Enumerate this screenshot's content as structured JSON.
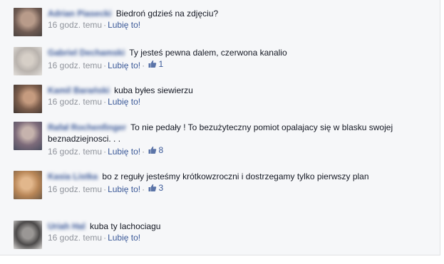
{
  "colors": {
    "link": "#3b5998",
    "meta": "#90949c",
    "text": "#141823",
    "panel": "#f6f7f9"
  },
  "comments": [
    {
      "name": "Adrian Piasecki",
      "text": "Biedroń gdzieś na zdjęciu?",
      "time": "16 godz. temu",
      "like_label": "Lubię to!",
      "like_count": null
    },
    {
      "name": "Gabriel Dechamski",
      "text": "Ty jesteś pewna dalem, czerwona kanalio",
      "time": "16 godz. temu",
      "like_label": "Lubię to!",
      "like_count": "1"
    },
    {
      "name": "Kamil Barański",
      "text": "kuba byłes siewierzu",
      "time": "16 godz. temu",
      "like_label": "Lubię to!",
      "like_count": null
    },
    {
      "name": "Rafał Rochenfinger",
      "text": "To nie pedały ! To bezużyteczny pomiot opalajacy się w blasku swojej beznadziejnosci. . .",
      "time": "16 godz. temu",
      "like_label": "Lubię to!",
      "like_count": "8"
    },
    {
      "name": "Kasia Listka",
      "text": "bo z reguły jesteśmy krótkowzroczni i dostrzegamy tylko pierwszy plan",
      "time": "16 godz. temu",
      "like_label": "Lubię to!",
      "like_count": "3"
    },
    {
      "name": "Uriah Hal",
      "text": "kuba ty lachociagu",
      "time": "16 godz. temu",
      "like_label": "Lubię to!",
      "like_count": null
    }
  ]
}
